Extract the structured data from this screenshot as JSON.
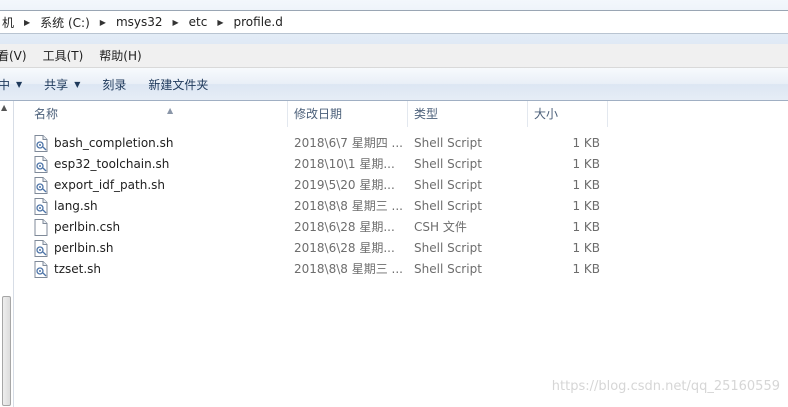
{
  "breadcrumb": [
    "机",
    "系统 (C:)",
    "msys32",
    "etc",
    "profile.d"
  ],
  "menu": [
    "看(V)",
    "工具(T)",
    "帮助(H)"
  ],
  "commands": [
    {
      "label": "中",
      "dropdown": true
    },
    {
      "label": "共享",
      "dropdown": true
    },
    {
      "label": "刻录",
      "dropdown": false
    },
    {
      "label": "新建文件夹",
      "dropdown": false
    }
  ],
  "columns": {
    "name": "名称",
    "date": "修改日期",
    "type": "类型",
    "size": "大小"
  },
  "files": [
    {
      "name": "bash_completion.sh",
      "date": "2018\\6\\7 星期四 ...",
      "type": "Shell Script",
      "size": "1 KB",
      "icon": "script-file-icon"
    },
    {
      "name": "esp32_toolchain.sh",
      "date": "2018\\10\\1 星期...",
      "type": "Shell Script",
      "size": "1 KB",
      "icon": "script-file-icon"
    },
    {
      "name": "export_idf_path.sh",
      "date": "2019\\5\\20 星期...",
      "type": "Shell Script",
      "size": "1 KB",
      "icon": "script-file-icon"
    },
    {
      "name": "lang.sh",
      "date": "2018\\8\\8 星期三 ...",
      "type": "Shell Script",
      "size": "1 KB",
      "icon": "script-file-icon"
    },
    {
      "name": "perlbin.csh",
      "date": "2018\\6\\28 星期...",
      "type": "CSH 文件",
      "size": "1 KB",
      "icon": "blank-file-icon"
    },
    {
      "name": "perlbin.sh",
      "date": "2018\\6\\28 星期...",
      "type": "Shell Script",
      "size": "1 KB",
      "icon": "script-file-icon"
    },
    {
      "name": "tzset.sh",
      "date": "2018\\8\\8 星期三 ...",
      "type": "Shell Script",
      "size": "1 KB",
      "icon": "script-file-icon"
    }
  ],
  "watermark": "https://blog.csdn.net/qq_25160559",
  "colors": {
    "accent": "#1e395b",
    "header_text": "#4c607a",
    "muted_text": "#6d6d6d"
  }
}
